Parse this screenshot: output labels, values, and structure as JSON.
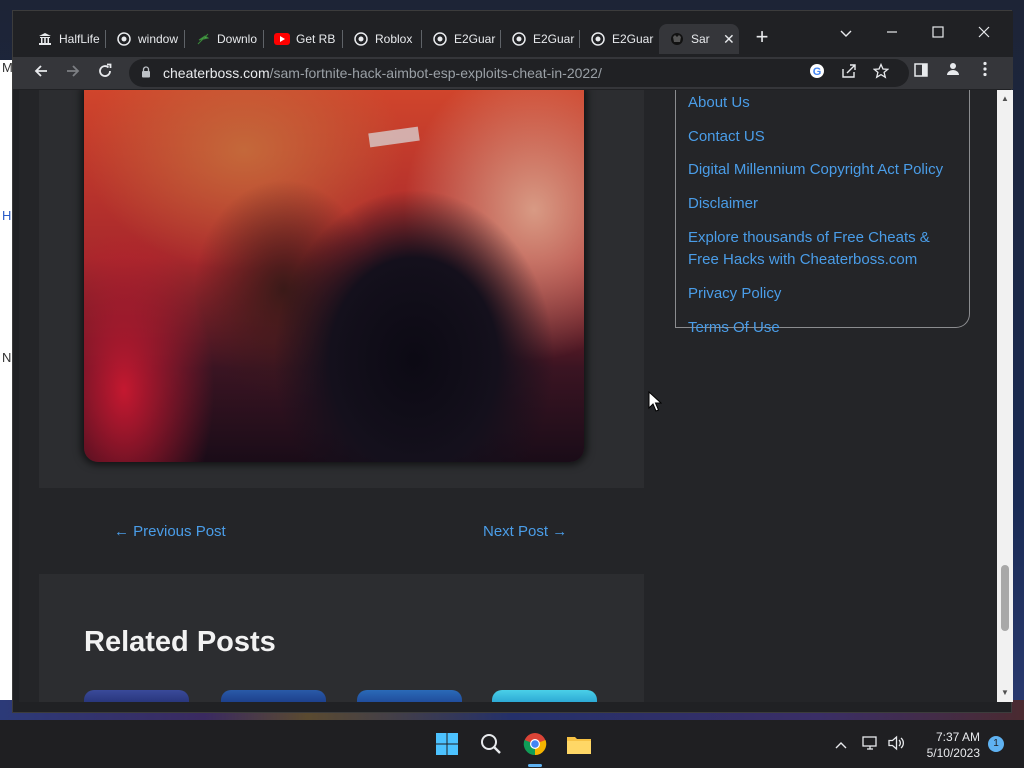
{
  "desktop": {
    "left_strip_letters": [
      "M",
      "H",
      "N"
    ]
  },
  "browser": {
    "tabs": [
      {
        "label": "HalfLife",
        "icon": "museum-icon"
      },
      {
        "label": "window",
        "icon": "globe-icon"
      },
      {
        "label": "Downlo",
        "icon": "leaf-icon"
      },
      {
        "label": "Get RB",
        "icon": "youtube-icon"
      },
      {
        "label": "Roblox",
        "icon": "globe-icon"
      },
      {
        "label": "E2Guar",
        "icon": "globe-icon"
      },
      {
        "label": "E2Guar",
        "icon": "globe-icon"
      },
      {
        "label": "E2Guar",
        "icon": "globe-icon"
      },
      {
        "label": "Sar",
        "icon": "site-icon",
        "active": true
      }
    ],
    "url_domain": "cheaterboss.com",
    "url_path": "/sam-fortnite-hack-aimbot-esp-exploits-cheat-in-2022/"
  },
  "page": {
    "post_nav": {
      "previous": "← Previous Post",
      "next": "Next Post →"
    },
    "related_posts_title": "Related Posts",
    "sidebar_links": [
      "About Us",
      "Contact US",
      "Digital Millennium Copyright Act Policy",
      "Disclaimer",
      "Explore thousands of Free Cheats & Free Hacks with Cheaterboss.com",
      "Privacy Policy",
      "Terms Of Use"
    ],
    "link_color": "#4a9de8",
    "scroll_position_fraction": 0.88
  },
  "taskbar": {
    "time": "7:37 AM",
    "date": "5/10/2023",
    "notification_count": "1",
    "accent": "#5fb2f2"
  }
}
